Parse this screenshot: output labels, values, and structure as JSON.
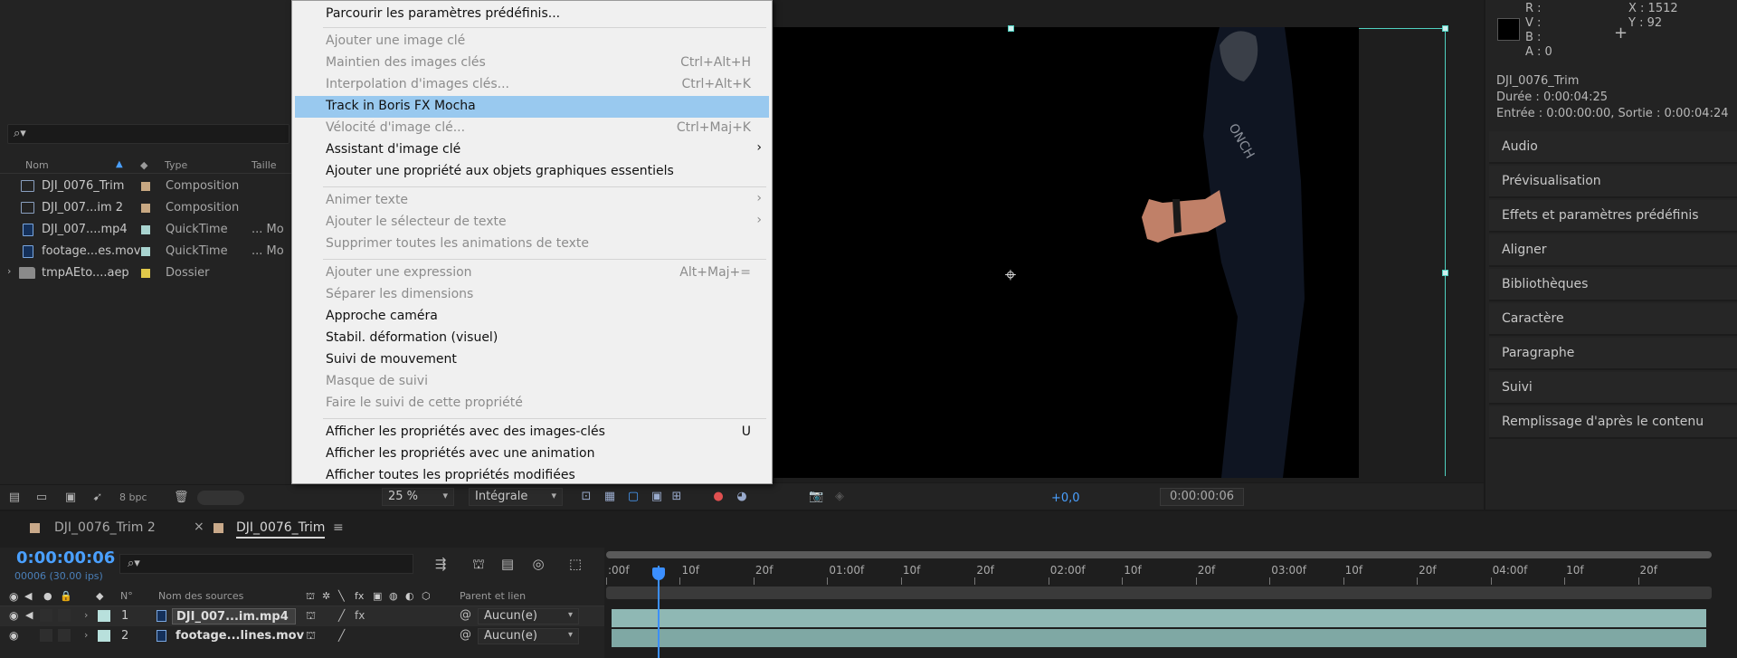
{
  "project_panel": {
    "search_placeholder": "",
    "columns": {
      "name": "Nom",
      "type": "Type",
      "size": "Taille"
    },
    "items": [
      {
        "name": "DJI_0076_Trim",
        "type": "Composition",
        "size": "",
        "label_color": "#c8a882",
        "icon": "composition-icon"
      },
      {
        "name": "DJI_007...im 2",
        "type": "Composition",
        "size": "",
        "label_color": "#c8a882",
        "icon": "composition-icon"
      },
      {
        "name": "DJI_007....mp4",
        "type": "QuickTime",
        "size": "... Mo",
        "label_color": "#a9d4d0",
        "icon": "footage-icon"
      },
      {
        "name": "footage...es.mov",
        "type": "QuickTime",
        "size": "... Mo",
        "label_color": "#a9d4d0",
        "icon": "footage-icon"
      },
      {
        "name": "tmpAEto....aep",
        "type": "Dossier",
        "size": "",
        "label_color": "#e0c84a",
        "icon": "folder-icon"
      }
    ],
    "bpc": "8 bpc"
  },
  "context_menu": {
    "items": [
      {
        "label": "Parcourir les paramètres prédéfinis...",
        "shortcut": "",
        "disabled": false
      },
      {
        "label": "Ajouter une image clé",
        "shortcut": "",
        "disabled": true
      },
      {
        "label": "Maintien des images clés",
        "shortcut": "Ctrl+Alt+H",
        "disabled": true
      },
      {
        "label": "Interpolation d'images clés...",
        "shortcut": "Ctrl+Alt+K",
        "disabled": true
      },
      {
        "label": "Track in Boris FX Mocha",
        "shortcut": "",
        "disabled": false,
        "highlighted": true
      },
      {
        "label": "Vélocité d'image clé...",
        "shortcut": "Ctrl+Maj+K",
        "disabled": true
      },
      {
        "label": "Assistant d'image clé",
        "shortcut": "",
        "disabled": false,
        "submenu": true
      },
      {
        "label": "Ajouter une propriété aux objets graphiques essentiels",
        "shortcut": "",
        "disabled": false
      },
      {
        "label": "Animer texte",
        "shortcut": "",
        "disabled": true,
        "submenu": true
      },
      {
        "label": "Ajouter le sélecteur de texte",
        "shortcut": "",
        "disabled": true,
        "submenu": true
      },
      {
        "label": "Supprimer toutes les animations de texte",
        "shortcut": "",
        "disabled": true
      },
      {
        "label": "Ajouter une expression",
        "shortcut": "Alt+Maj+=",
        "disabled": true
      },
      {
        "label": "Séparer les dimensions",
        "shortcut": "",
        "disabled": true
      },
      {
        "label": "Approche caméra",
        "shortcut": "",
        "disabled": false
      },
      {
        "label": "Stabil. déformation (visuel)",
        "shortcut": "",
        "disabled": false
      },
      {
        "label": "Suivi de mouvement",
        "shortcut": "",
        "disabled": false
      },
      {
        "label": "Masque de suivi",
        "shortcut": "",
        "disabled": true
      },
      {
        "label": "Faire le suivi de cette propriété",
        "shortcut": "",
        "disabled": true
      },
      {
        "label": "Afficher les propriétés avec des images-clés",
        "shortcut": "U",
        "disabled": false
      },
      {
        "label": "Afficher les propriétés avec une animation",
        "shortcut": "",
        "disabled": false
      },
      {
        "label": "Afficher toutes les propriétés modifiées",
        "shortcut": "",
        "disabled": false
      }
    ]
  },
  "viewer": {
    "zoom": "25 %",
    "resolution": "Intégrale",
    "exposure": "+0,0",
    "timecode": "0:00:00:06"
  },
  "info_panel": {
    "r": "R :",
    "v": "V :",
    "b": "B :",
    "a": "A : 0",
    "x": "X : 1512",
    "y": "Y : 92",
    "item_name": "DJI_0076_Trim",
    "duration": "Durée : 0:00:04:25",
    "in_out": "Entrée : 0:00:00:00, Sortie : 0:00:04:24"
  },
  "right_panels": [
    "Audio",
    "Prévisualisation",
    "Effets et paramètres prédéfinis",
    "Aligner",
    "Bibliothèques",
    "Caractère",
    "Paragraphe",
    "Suivi",
    "Remplissage d'après le contenu"
  ],
  "timeline": {
    "tabs": [
      {
        "label": "DJI_0076_Trim 2",
        "active": false,
        "closable": false
      },
      {
        "label": "DJI_0076_Trim",
        "active": true,
        "closable": true
      }
    ],
    "close_glyph": "×",
    "menu_glyph": "≡",
    "current_time": "0:00:00:06",
    "current_frames": "00006 (30.00 ips)",
    "columns": {
      "number": "N°",
      "source_name": "Nom des sources",
      "parent": "Parent et lien"
    },
    "layers": [
      {
        "number": "1",
        "name": "DJI_007...im.mp4",
        "parent": "Aucun(e)",
        "selected": true
      },
      {
        "number": "2",
        "name": "footage...lines.mov",
        "parent": "Aucun(e)",
        "selected": false
      }
    ],
    "ruler_labels": [
      ":00f",
      "10f",
      "20f",
      "01:00f",
      "10f",
      "20f",
      "02:00f",
      "10f",
      "20f",
      "03:00f",
      "10f",
      "20f",
      "04:00f",
      "10f",
      "20f"
    ],
    "accent_color": "#3b8fff",
    "layer_bar_color": "#8fb8b4"
  }
}
